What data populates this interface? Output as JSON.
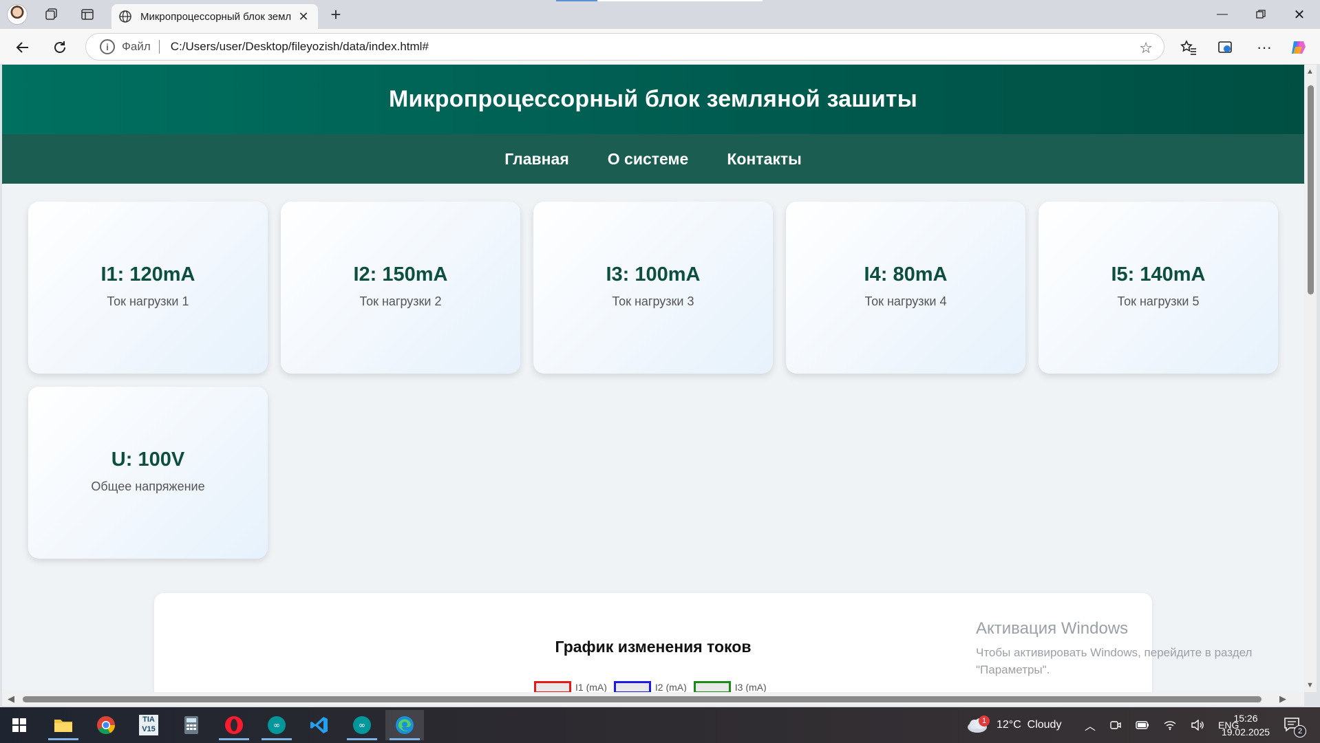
{
  "browser": {
    "tab_title": "Микропроцессорный блок земл",
    "address_scheme_label": "Файл",
    "address_url": "C:/Users/user/Desktop/fileyozish/data/index.html#"
  },
  "site": {
    "title": "Микропроцессорный блок земляной зашиты",
    "nav": [
      "Главная",
      "О системе",
      "Контакты"
    ]
  },
  "cards": [
    {
      "value": "I1: 120mA",
      "label": "Ток нагрузки 1"
    },
    {
      "value": "I2: 150mA",
      "label": "Ток нагрузки 2"
    },
    {
      "value": "I3: 100mA",
      "label": "Ток нагрузки 3"
    },
    {
      "value": "I4: 80mA",
      "label": "Ток нагрузки 4"
    },
    {
      "value": "I5: 140mA",
      "label": "Ток нагрузки 5"
    },
    {
      "value": "U: 100V",
      "label": "Общее напряжение"
    }
  ],
  "chart": {
    "title": "График изменения токов",
    "legend": [
      {
        "name": "I1 (mA)",
        "color": "#e31b1b"
      },
      {
        "name": "I2 (mA)",
        "color": "#1b1be3"
      },
      {
        "name": "I3 (mA)",
        "color": "#1b8a1b"
      }
    ]
  },
  "watermark": {
    "line1": "Активация Windows",
    "line2": "Чтобы активировать Windows, перейдите в раздел",
    "line3": "\"Параметры\"."
  },
  "taskbar": {
    "weather": "12°C  Cloudy",
    "weather_badge": "1",
    "lang": "ENG",
    "time": "15:26",
    "date": "19.02.2025",
    "notif_count": "2"
  },
  "colors": {
    "header_bg": "#006b5b",
    "nav_bg": "#1b5d50",
    "card_value": "#0c4f3f"
  }
}
